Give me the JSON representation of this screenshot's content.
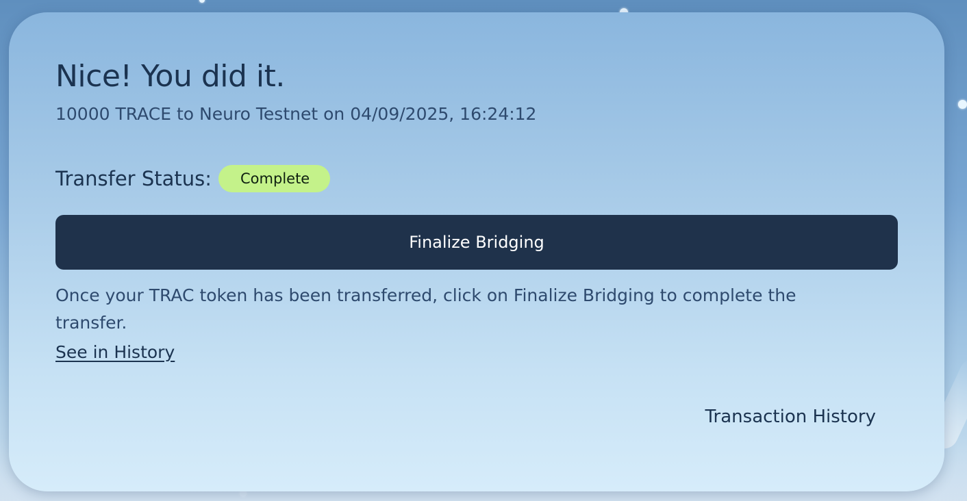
{
  "dialog": {
    "headline": "Nice! You did it.",
    "summary": "10000 TRACE to Neuro Testnet on 04/09/2025, 16:24:12",
    "status_label": "Transfer Status:",
    "status_value": "Complete",
    "primary_button_label": "Finalize Bridging",
    "hint_text": "Once your TRAC token has been transferred, click on Finalize Bridging to complete the transfer.",
    "history_link_label": "See in History",
    "transaction_history_label": "Transaction History"
  },
  "colors": {
    "card_background": "#a8cbe8",
    "primary_button": "#1f324b",
    "status_badge": "#c4f28a",
    "heading_text": "#1b3350"
  }
}
